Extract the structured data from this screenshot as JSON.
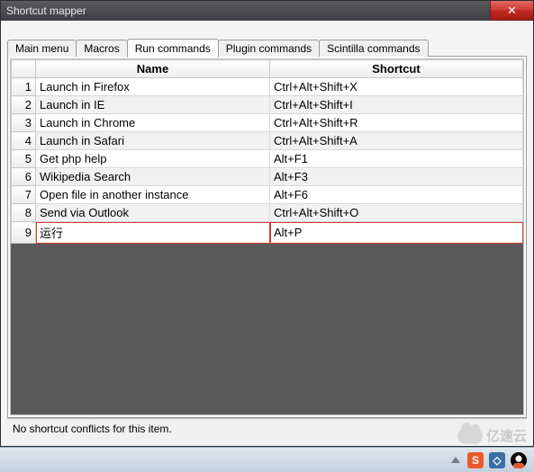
{
  "window": {
    "title": "Shortcut mapper",
    "close_icon_glyph": "✕"
  },
  "tabs": [
    {
      "label": "Main menu",
      "active": false
    },
    {
      "label": "Macros",
      "active": false
    },
    {
      "label": "Run commands",
      "active": true
    },
    {
      "label": "Plugin commands",
      "active": false
    },
    {
      "label": "Scintilla commands",
      "active": false
    }
  ],
  "columns": {
    "name": "Name",
    "shortcut": "Shortcut"
  },
  "rows": [
    {
      "num": "1",
      "name": "Launch in Firefox",
      "shortcut": "Ctrl+Alt+Shift+X",
      "highlight": false
    },
    {
      "num": "2",
      "name": "Launch in IE",
      "shortcut": "Ctrl+Alt+Shift+I",
      "highlight": false
    },
    {
      "num": "3",
      "name": "Launch in Chrome",
      "shortcut": "Ctrl+Alt+Shift+R",
      "highlight": false
    },
    {
      "num": "4",
      "name": "Launch in Safari",
      "shortcut": "Ctrl+Alt+Shift+A",
      "highlight": false
    },
    {
      "num": "5",
      "name": "Get php help",
      "shortcut": "Alt+F1",
      "highlight": false
    },
    {
      "num": "6",
      "name": "Wikipedia Search",
      "shortcut": "Alt+F3",
      "highlight": false
    },
    {
      "num": "7",
      "name": "Open file in another instance",
      "shortcut": "Alt+F6",
      "highlight": false
    },
    {
      "num": "8",
      "name": "Send via Outlook",
      "shortcut": "Ctrl+Alt+Shift+O",
      "highlight": false
    },
    {
      "num": "9",
      "name": "运行",
      "shortcut": "Alt+P",
      "highlight": true
    }
  ],
  "status": {
    "message": "No shortcut conflicts for this item."
  },
  "watermark": {
    "text": "亿速云"
  }
}
